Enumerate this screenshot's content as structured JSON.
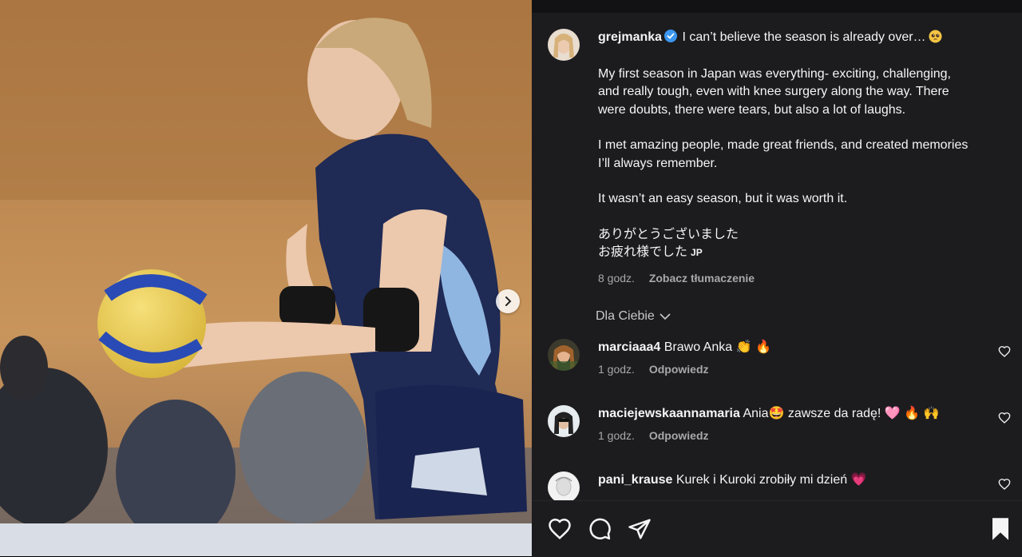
{
  "post": {
    "username": "grejmanka",
    "caption_first": "I can’t believe the season is already over…",
    "paragraphs": [
      [
        "My first season in Japan was everything- exciting, challenging,",
        "and really tough, even with knee surgery along the way. There",
        "were doubts, there were tears, but also a lot of laughs."
      ],
      [
        "I met amazing people, made great friends, and created memories",
        "I’ll always remember."
      ],
      [
        "It wasn’t an easy season, but it was worth it."
      ]
    ],
    "jp_line1": "ありがとうございました",
    "jp_line2": "お疲れ様でした",
    "jp_tag": "JP",
    "time": "8 godz.",
    "translate": "Zobacz tłumaczenie"
  },
  "filter": {
    "label": "Dla Ciebie"
  },
  "comments": [
    {
      "username": "marciaaa4",
      "text": "Brawo Anka 👏 🔥",
      "time": "1 godz.",
      "reply": "Odpowiedz"
    },
    {
      "username": "maciejewskaannamaria",
      "text": "Ania🤩 zawsze da radę! 🩷 🔥 🙌",
      "time": "1 godz.",
      "reply": "Odpowiedz"
    },
    {
      "username": "pani_krause",
      "text": "Kurek i Kuroki zrobiły mi dzień",
      "heart": "💗"
    }
  ],
  "icons": {
    "like": "heart-icon",
    "comment": "comment-icon",
    "share": "share-icon",
    "save": "bookmark-icon",
    "next": "chevron-right-icon"
  },
  "colors": {
    "panel_bg": "#1c1c1f",
    "verified": "#3b97f0",
    "muted": "#a8a8a8"
  }
}
